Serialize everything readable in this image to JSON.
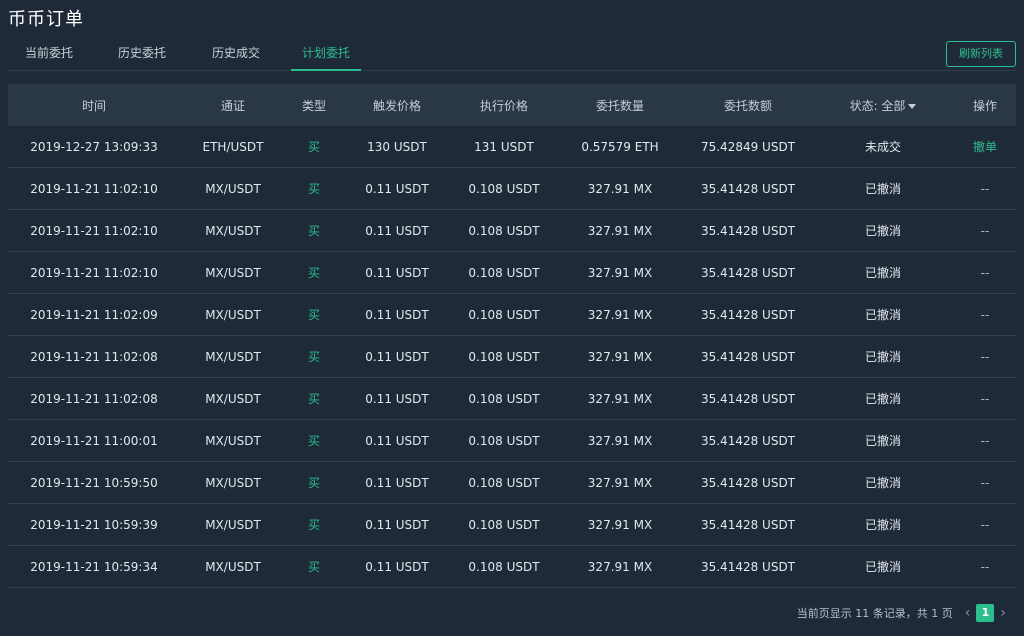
{
  "page_title": "币币订单",
  "tabs": [
    "当前委托",
    "历史委托",
    "历史成交",
    "计划委托"
  ],
  "active_tab": "计划委托",
  "refresh_label": "刷新列表",
  "columns": {
    "time": "时间",
    "pair": "通证",
    "type": "类型",
    "trigger_price": "触发价格",
    "exec_price": "执行价格",
    "amount": "委托数量",
    "total": "委托数额",
    "status": "状态: 全部",
    "action": "操作"
  },
  "rows": [
    {
      "time": "2019-12-27 13:09:33",
      "pair": "ETH/USDT",
      "type": "买",
      "trigger_price": "130 USDT",
      "exec_price": "131 USDT",
      "amount": "0.57579 ETH",
      "total": "75.42849 USDT",
      "status": "未成交",
      "action": "撤单"
    },
    {
      "time": "2019-11-21 11:02:10",
      "pair": "MX/USDT",
      "type": "买",
      "trigger_price": "0.11 USDT",
      "exec_price": "0.108 USDT",
      "amount": "327.91 MX",
      "total": "35.41428 USDT",
      "status": "已撤消",
      "action": "--"
    },
    {
      "time": "2019-11-21 11:02:10",
      "pair": "MX/USDT",
      "type": "买",
      "trigger_price": "0.11 USDT",
      "exec_price": "0.108 USDT",
      "amount": "327.91 MX",
      "total": "35.41428 USDT",
      "status": "已撤消",
      "action": "--"
    },
    {
      "time": "2019-11-21 11:02:10",
      "pair": "MX/USDT",
      "type": "买",
      "trigger_price": "0.11 USDT",
      "exec_price": "0.108 USDT",
      "amount": "327.91 MX",
      "total": "35.41428 USDT",
      "status": "已撤消",
      "action": "--"
    },
    {
      "time": "2019-11-21 11:02:09",
      "pair": "MX/USDT",
      "type": "买",
      "trigger_price": "0.11 USDT",
      "exec_price": "0.108 USDT",
      "amount": "327.91 MX",
      "total": "35.41428 USDT",
      "status": "已撤消",
      "action": "--"
    },
    {
      "time": "2019-11-21 11:02:08",
      "pair": "MX/USDT",
      "type": "买",
      "trigger_price": "0.11 USDT",
      "exec_price": "0.108 USDT",
      "amount": "327.91 MX",
      "total": "35.41428 USDT",
      "status": "已撤消",
      "action": "--"
    },
    {
      "time": "2019-11-21 11:02:08",
      "pair": "MX/USDT",
      "type": "买",
      "trigger_price": "0.11 USDT",
      "exec_price": "0.108 USDT",
      "amount": "327.91 MX",
      "total": "35.41428 USDT",
      "status": "已撤消",
      "action": "--"
    },
    {
      "time": "2019-11-21 11:00:01",
      "pair": "MX/USDT",
      "type": "买",
      "trigger_price": "0.11 USDT",
      "exec_price": "0.108 USDT",
      "amount": "327.91 MX",
      "total": "35.41428 USDT",
      "status": "已撤消",
      "action": "--"
    },
    {
      "time": "2019-11-21 10:59:50",
      "pair": "MX/USDT",
      "type": "买",
      "trigger_price": "0.11 USDT",
      "exec_price": "0.108 USDT",
      "amount": "327.91 MX",
      "total": "35.41428 USDT",
      "status": "已撤消",
      "action": "--"
    },
    {
      "time": "2019-11-21 10:59:39",
      "pair": "MX/USDT",
      "type": "买",
      "trigger_price": "0.11 USDT",
      "exec_price": "0.108 USDT",
      "amount": "327.91 MX",
      "total": "35.41428 USDT",
      "status": "已撤消",
      "action": "--"
    },
    {
      "time": "2019-11-21 10:59:34",
      "pair": "MX/USDT",
      "type": "买",
      "trigger_price": "0.11 USDT",
      "exec_price": "0.108 USDT",
      "amount": "327.91 MX",
      "total": "35.41428 USDT",
      "status": "已撤消",
      "action": "--"
    }
  ],
  "pagination": {
    "summary": "当前页显示 11 条记录，共 1 页",
    "current_page": "1",
    "prev_icon": "chevron-left-icon",
    "next_icon": "chevron-right-icon"
  },
  "colors": {
    "background": "#1e2a37",
    "header_bg": "#2a3747",
    "accent": "#2dbe8f"
  }
}
